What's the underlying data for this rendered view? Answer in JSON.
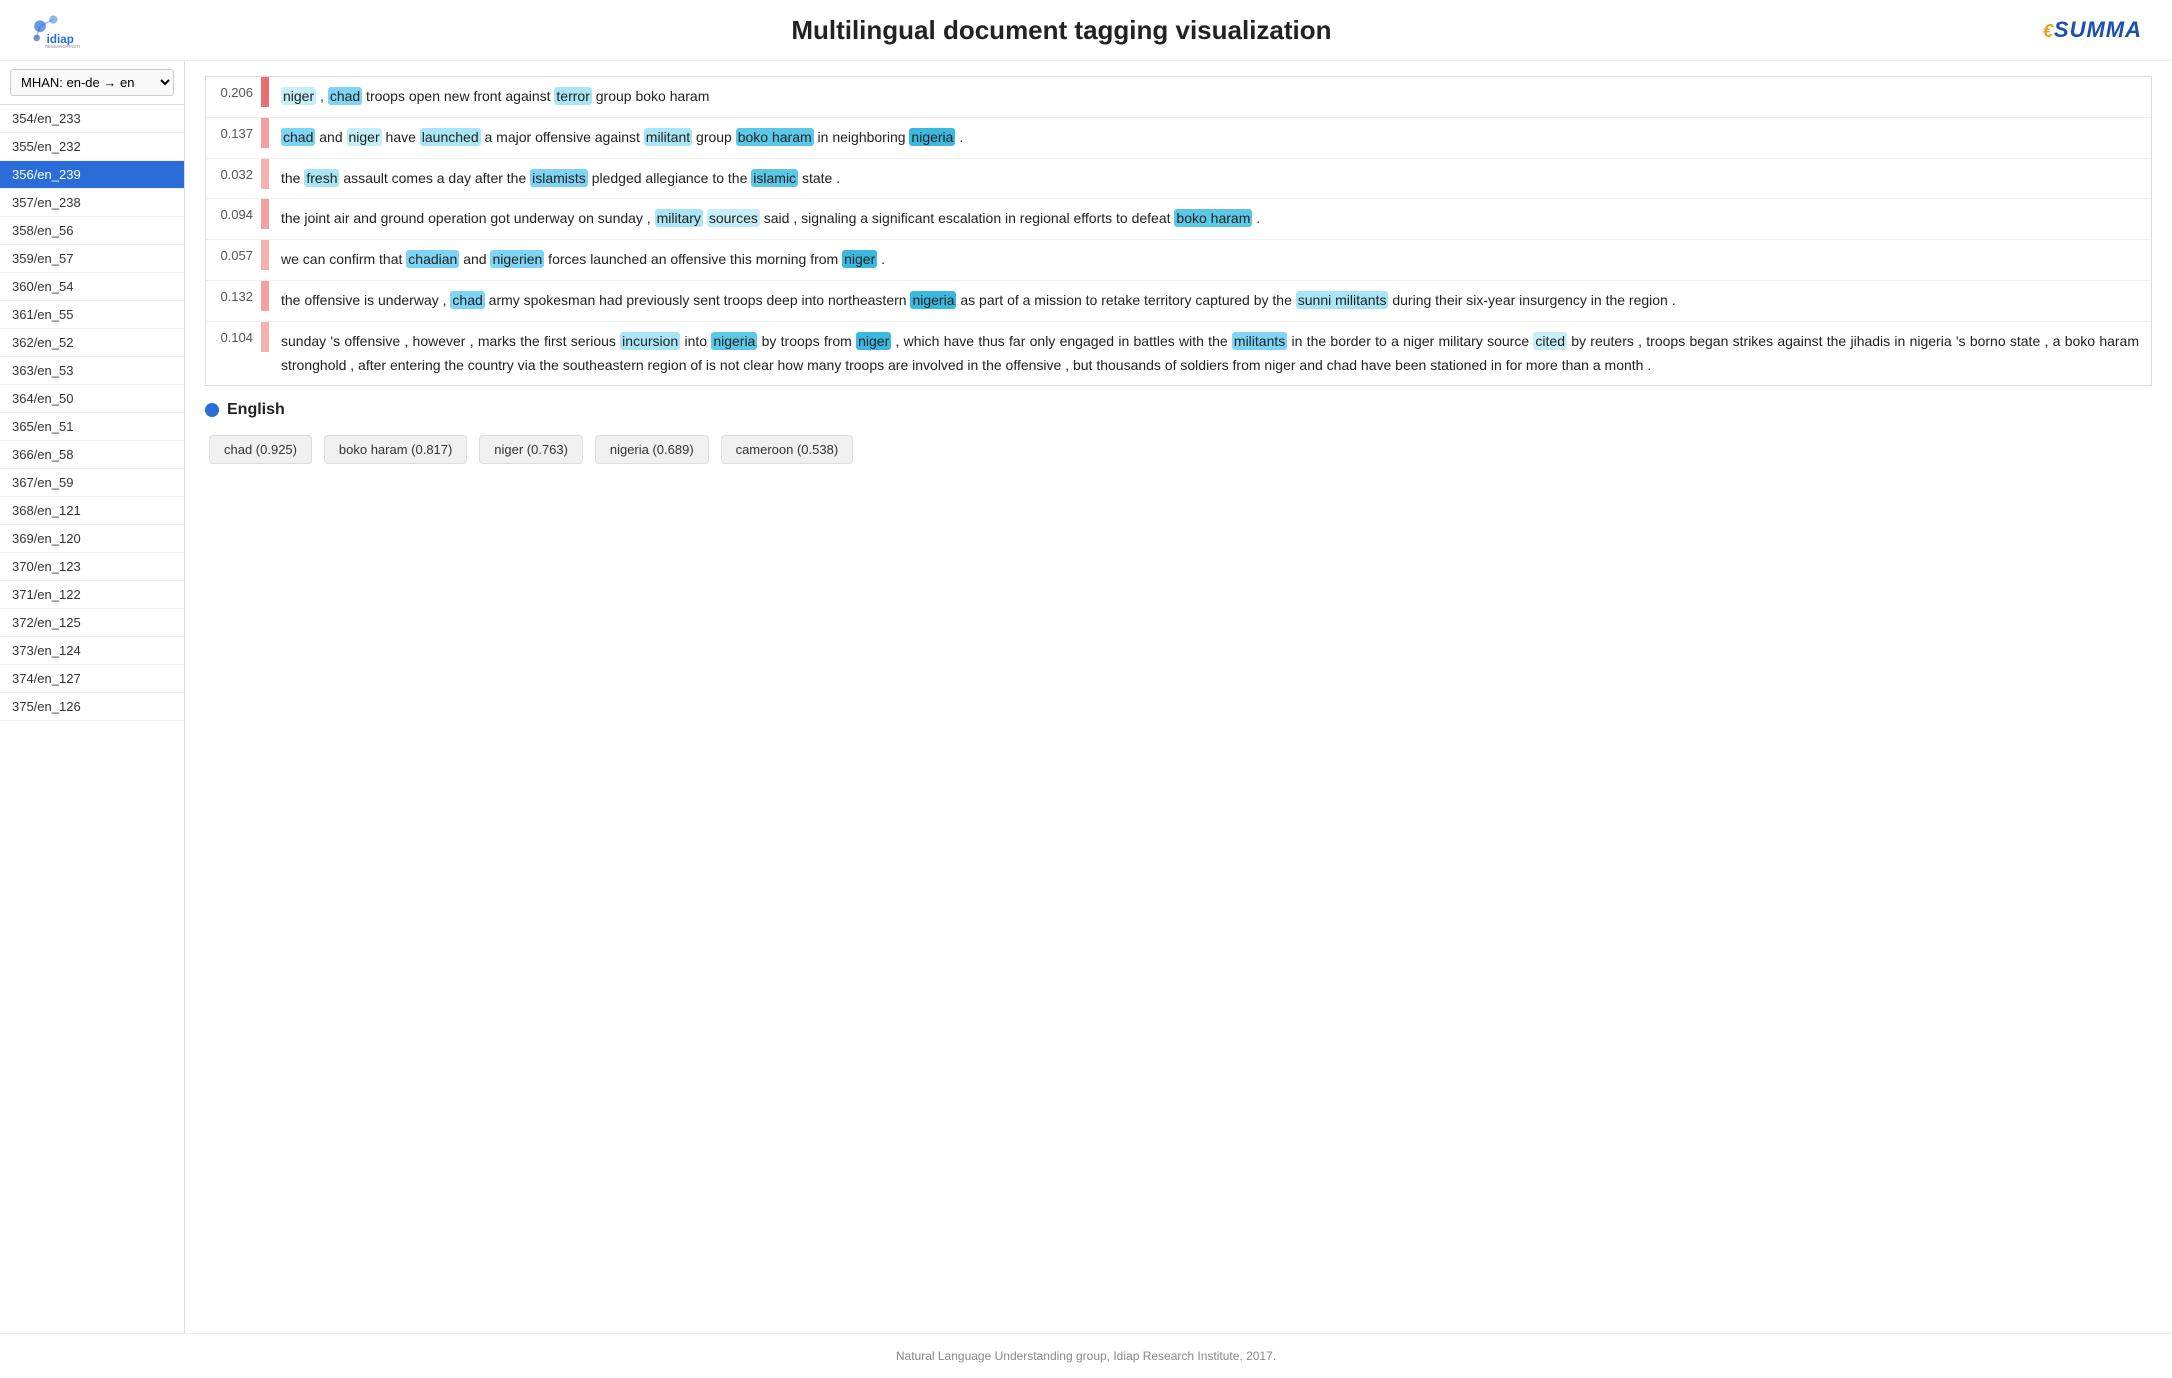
{
  "header": {
    "title": "Multilingual document tagging visualization",
    "idiap_name": "idiap",
    "idiap_sub": "Research Institute",
    "summa_text": "SUMMA"
  },
  "sidebar": {
    "selector_label": "MHAN: en-de → en",
    "items": [
      {
        "id": "354/en_233",
        "label": "354/en_233",
        "active": false
      },
      {
        "id": "355/en_232",
        "label": "355/en_232",
        "active": false
      },
      {
        "id": "356/en_239",
        "label": "356/en_239",
        "active": true
      },
      {
        "id": "357/en_238",
        "label": "357/en_238",
        "active": false
      },
      {
        "id": "358/en_56",
        "label": "358/en_56",
        "active": false
      },
      {
        "id": "359/en_57",
        "label": "359/en_57",
        "active": false
      },
      {
        "id": "360/en_54",
        "label": "360/en_54",
        "active": false
      },
      {
        "id": "361/en_55",
        "label": "361/en_55",
        "active": false
      },
      {
        "id": "362/en_52",
        "label": "362/en_52",
        "active": false
      },
      {
        "id": "363/en_53",
        "label": "363/en_53",
        "active": false
      },
      {
        "id": "364/en_50",
        "label": "364/en_50",
        "active": false
      },
      {
        "id": "365/en_51",
        "label": "365/en_51",
        "active": false
      },
      {
        "id": "366/en_58",
        "label": "366/en_58",
        "active": false
      },
      {
        "id": "367/en_59",
        "label": "367/en_59",
        "active": false
      },
      {
        "id": "368/en_121",
        "label": "368/en_121",
        "active": false
      },
      {
        "id": "369/en_120",
        "label": "369/en_120",
        "active": false
      },
      {
        "id": "370/en_123",
        "label": "370/en_123",
        "active": false
      },
      {
        "id": "371/en_122",
        "label": "371/en_122",
        "active": false
      },
      {
        "id": "372/en_125",
        "label": "372/en_125",
        "active": false
      },
      {
        "id": "373/en_124",
        "label": "373/en_124",
        "active": false
      },
      {
        "id": "374/en_127",
        "label": "374/en_127",
        "active": false
      },
      {
        "id": "375/en_126",
        "label": "375/en_126",
        "active": false
      }
    ]
  },
  "document": {
    "paragraphs": [
      {
        "score": "0.206",
        "bar_color": "bar-red-medium",
        "bar_height": "100%"
      },
      {
        "score": "0.137",
        "bar_color": "bar-red-light",
        "bar_height": "67%"
      },
      {
        "score": "0.032",
        "bar_color": "bar-pink",
        "bar_height": "15%"
      },
      {
        "score": "0.094",
        "bar_color": "bar-red-light",
        "bar_height": "46%"
      },
      {
        "score": "0.057",
        "bar_color": "bar-pink",
        "bar_height": "28%"
      },
      {
        "score": "0.132",
        "bar_color": "bar-red-light",
        "bar_height": "64%"
      },
      {
        "score": "0.104",
        "bar_color": "bar-pink",
        "bar_height": "50%"
      }
    ]
  },
  "tags": {
    "language_label": "English",
    "items": [
      {
        "label": "chad (0.925)"
      },
      {
        "label": "boko haram (0.817)"
      },
      {
        "label": "niger (0.763)"
      },
      {
        "label": "nigeria (0.689)"
      },
      {
        "label": "cameroon (0.538)"
      }
    ]
  },
  "footer": {
    "text": "Natural Language Understanding group, Idiap Research Institute, 2017."
  }
}
